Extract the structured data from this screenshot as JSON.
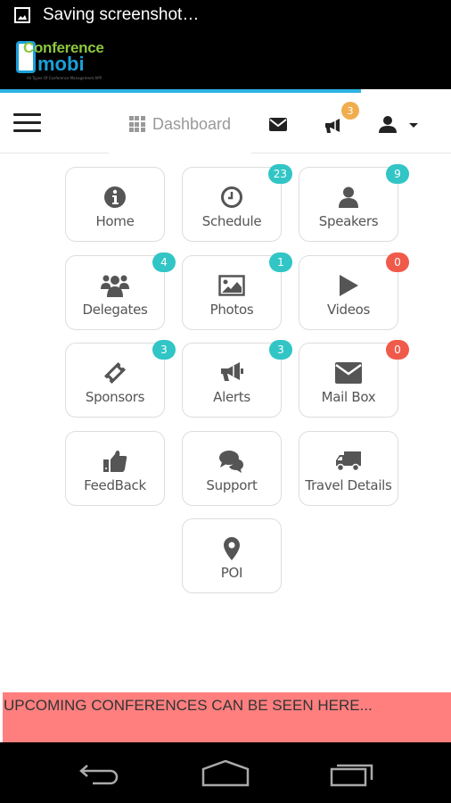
{
  "status_bar": {
    "icon": "image-icon",
    "text": "Saving screenshot…"
  },
  "logo": {
    "line1": "Conference",
    "line2": "mobi",
    "tagline": "All Types Of Conference Management APP"
  },
  "page_load_progress": 0.8,
  "navbar": {
    "menu_icon": "hamburger-icon",
    "title": "Dashboard",
    "title_icon": "grid-icon",
    "mail_icon": "envelope-icon",
    "alerts_icon": "megaphone-icon",
    "alerts_count": "3",
    "user_icon": "user-icon",
    "user_dropdown_icon": "caret-down-icon"
  },
  "colors": {
    "teal_badge": "#32c5c5",
    "red_badge": "#f05a4a",
    "orange_badge": "#f0ad4e",
    "accent": "#2bb3e3",
    "banner": "#ff7f7f"
  },
  "tiles": [
    {
      "label": "Home",
      "icon": "info-circle-icon",
      "badge": null
    },
    {
      "label": "Schedule",
      "icon": "clock-icon",
      "badge": "23",
      "badge_color": "teal"
    },
    {
      "label": "Speakers",
      "icon": "user-icon",
      "badge": "9",
      "badge_color": "teal"
    },
    {
      "label": "Delegates",
      "icon": "users-icon",
      "badge": "4",
      "badge_color": "teal"
    },
    {
      "label": "Photos",
      "icon": "picture-icon",
      "badge": "1",
      "badge_color": "teal"
    },
    {
      "label": "Videos",
      "icon": "play-icon",
      "badge": "0",
      "badge_color": "red"
    },
    {
      "label": "Sponsors",
      "icon": "ticket-icon",
      "badge": "3",
      "badge_color": "teal"
    },
    {
      "label": "Alerts",
      "icon": "megaphone-icon",
      "badge": "3",
      "badge_color": "teal"
    },
    {
      "label": "Mail Box",
      "icon": "envelope-icon",
      "badge": "0",
      "badge_color": "red"
    },
    {
      "label": "FeedBack",
      "icon": "thumbs-up-icon",
      "badge": null
    },
    {
      "label": "Support",
      "icon": "comments-icon",
      "badge": null
    },
    {
      "label": "Travel Details",
      "icon": "truck-icon",
      "badge": null
    },
    {
      "label": "POI",
      "icon": "map-marker-icon",
      "badge": null
    }
  ],
  "banner": {
    "text": "UPCOMING CONFERENCES CAN BE SEEN HERE..."
  },
  "system_nav": {
    "back": "back-icon",
    "home": "home-icon",
    "recents": "recents-icon"
  }
}
